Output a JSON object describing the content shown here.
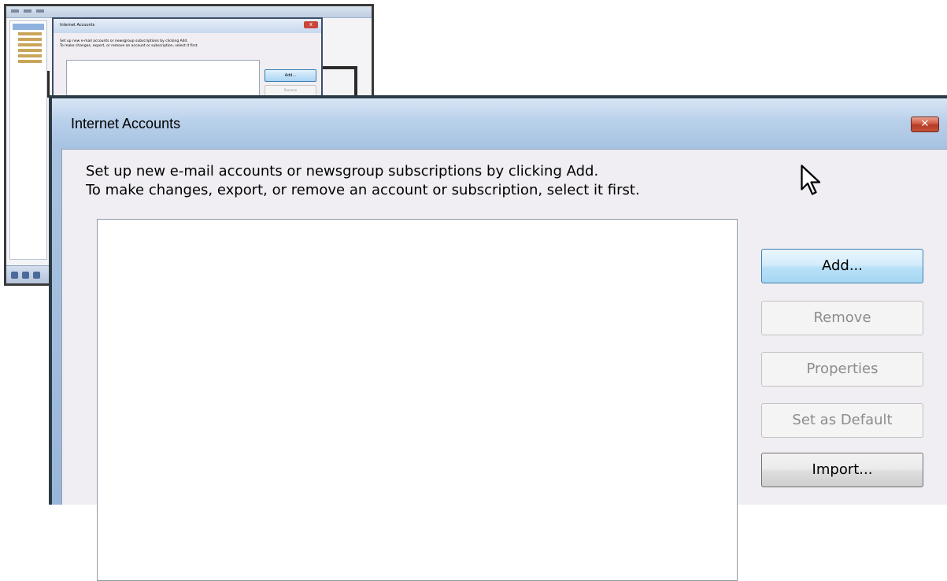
{
  "thumbnail": {
    "dialog_title": "Internet Accounts",
    "description_line1": "Set up new e-mail accounts or newsgroup subscriptions by clicking Add.",
    "description_line2": "To make changes, export, or remove an account or subscription, select it first.",
    "add_label": "Add...",
    "remove_label": "Remove",
    "close_glyph": "x"
  },
  "dialog": {
    "title": "Internet Accounts",
    "close_glyph": "✕",
    "description_line1": "Set up new e-mail accounts or newsgroup subscriptions by clicking Add.",
    "description_line2": "To make changes, export, or remove an account or subscription, select it first.",
    "buttons": {
      "add": "Add...",
      "remove": "Remove",
      "properties": "Properties",
      "set_default": "Set as Default",
      "import": "Import..."
    },
    "disabled_buttons": [
      "remove",
      "properties",
      "set_default"
    ]
  },
  "colors": {
    "title_bar": "#b9d0ea",
    "close_button": "#c8533a",
    "content_bg": "#f0eef2",
    "add_button_border": "#3c7fb1"
  },
  "icons": [
    "close-icon",
    "mouse-pointer-icon"
  ]
}
